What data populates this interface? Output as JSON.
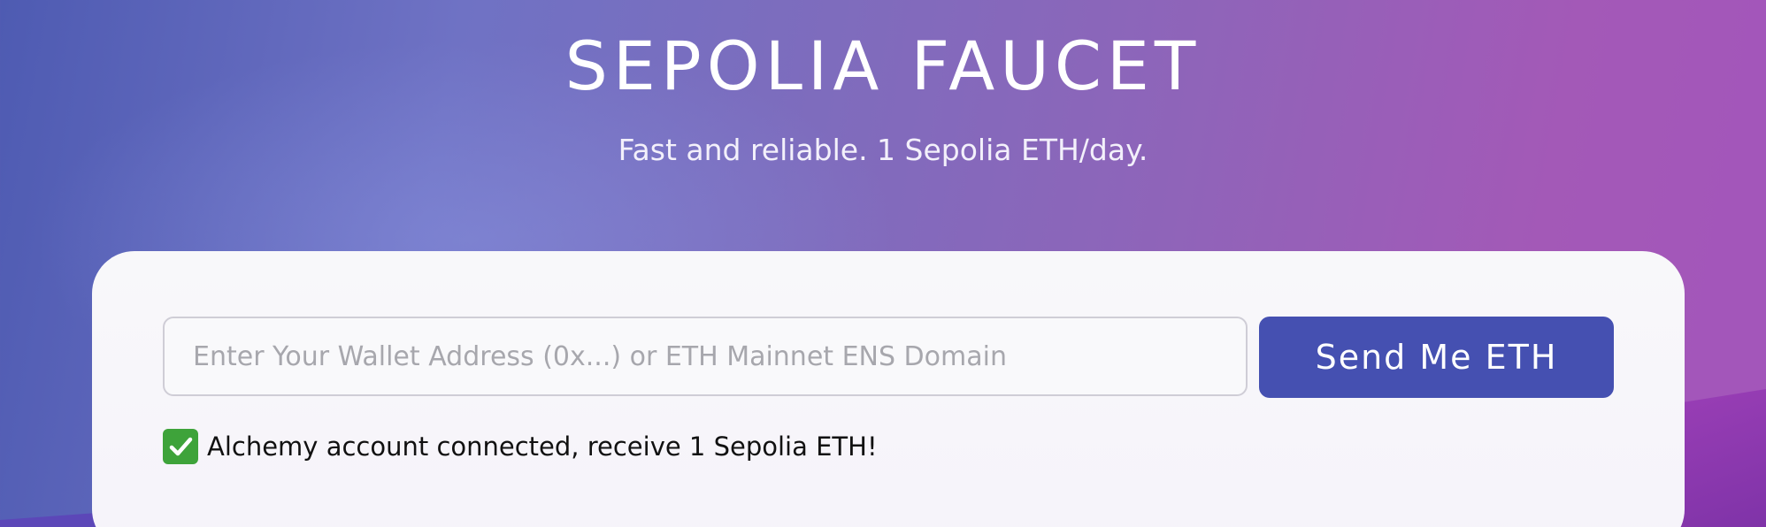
{
  "header": {
    "title": "SEPOLIA FAUCET",
    "subtitle": "Fast and reliable. 1 Sepolia ETH/day."
  },
  "form": {
    "wallet_input": {
      "placeholder": "Enter Your Wallet Address (0x...) or ETH Mainnet ENS Domain",
      "value": ""
    },
    "send_button_label": "Send Me ETH"
  },
  "status": {
    "icon": "check-mark-icon",
    "message": "Alchemy account connected, receive 1 Sepolia ETH!"
  },
  "colors": {
    "accent_button": "#4550b1",
    "success_check": "#3ea33a",
    "gradient_start": "#4e5bb2",
    "gradient_end": "#a355bb"
  }
}
